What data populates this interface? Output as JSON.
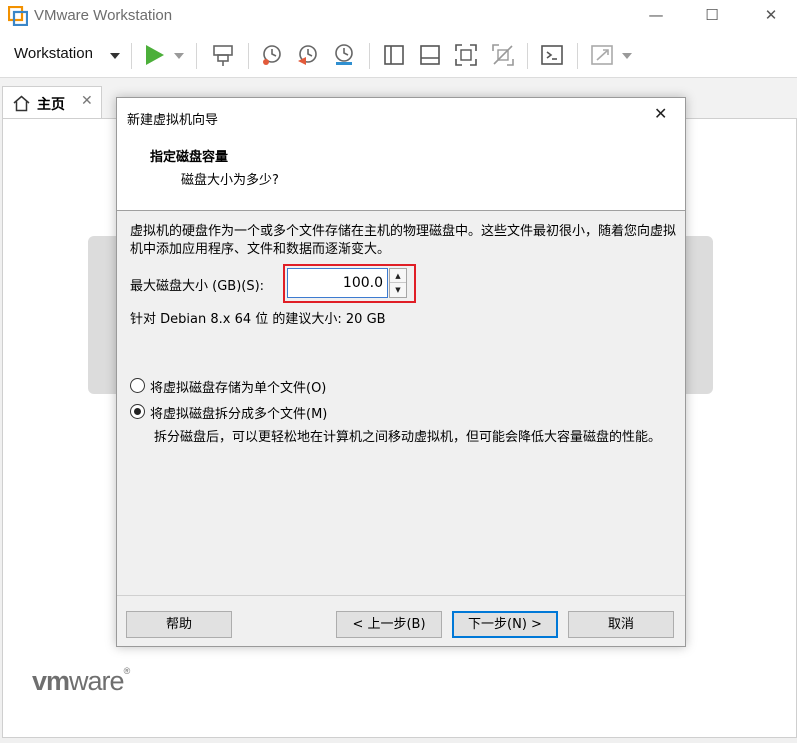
{
  "window": {
    "title": "VMware Workstation",
    "minimize_glyph": "—",
    "maximize_glyph": "☐",
    "close_glyph": "✕"
  },
  "toolbar": {
    "menu_label": "Workstation",
    "icons": [
      "play-icon",
      "network-adapter-icon",
      "snapshot-take-icon",
      "snapshot-revert-icon",
      "snapshot-manager-icon",
      "sidebar-toggle-icon",
      "bottom-panel-icon",
      "full-screen-icon",
      "unity-icon",
      "console-icon",
      "stretch-icon"
    ]
  },
  "tabs": [
    {
      "label": "主页",
      "close_glyph": "✕",
      "icon": "home-icon"
    }
  ],
  "brand": {
    "logo_vm": "vm",
    "logo_ware": "ware",
    "logo_reg": "®"
  },
  "dialog": {
    "title": "新建虚拟机向导",
    "close_glyph": "✕",
    "heading": "指定磁盘容量",
    "subheading": "磁盘大小为多少?",
    "description": "虚拟机的硬盘作为一个或多个文件存储在主机的物理磁盘中。这些文件最初很小，随着您向虚拟机中添加应用程序、文件和数据而逐渐变大。",
    "max_size_label": "最大磁盘大小 (GB)(S):",
    "max_size_value": "100.0",
    "recommended": "针对 Debian 8.x 64 位 的建议大小: 20 GB",
    "options": [
      {
        "label": "将虚拟磁盘存储为单个文件(O)",
        "checked": false
      },
      {
        "label": "将虚拟磁盘拆分成多个文件(M)",
        "checked": true
      }
    ],
    "split_note": "拆分磁盘后，可以更轻松地在计算机之间移动虚拟机，但可能会降低大容量磁盘的性能。",
    "buttons": {
      "help": "帮助",
      "back": "< 上一步(B)",
      "next": "下一步(N) >",
      "cancel": "取消"
    }
  },
  "colors": {
    "highlight_border": "#e01e26",
    "play_green": "#4caf3a",
    "snapshot_red": "#e25a3a",
    "snapshot_blue": "#2f8fd0",
    "focus_blue": "#0078d7"
  }
}
